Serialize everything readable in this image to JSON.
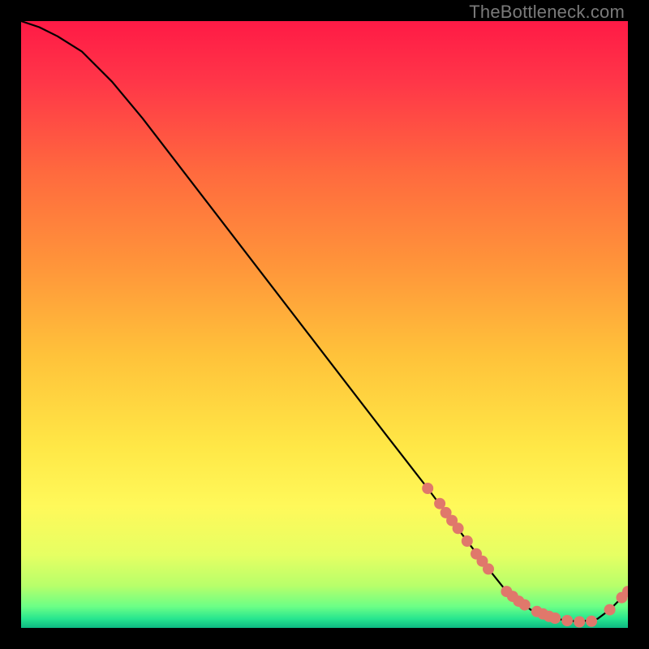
{
  "watermark": "TheBottleneck.com",
  "gradient_stops": [
    {
      "offset": 0.0,
      "color": "#ff1a46"
    },
    {
      "offset": 0.1,
      "color": "#ff3648"
    },
    {
      "offset": 0.25,
      "color": "#ff6a3e"
    },
    {
      "offset": 0.4,
      "color": "#ff943a"
    },
    {
      "offset": 0.55,
      "color": "#ffc23a"
    },
    {
      "offset": 0.7,
      "color": "#ffe746"
    },
    {
      "offset": 0.8,
      "color": "#fff95a"
    },
    {
      "offset": 0.88,
      "color": "#e6ff63"
    },
    {
      "offset": 0.93,
      "color": "#b8ff6a"
    },
    {
      "offset": 0.965,
      "color": "#6bff86"
    },
    {
      "offset": 0.985,
      "color": "#27e58f"
    },
    {
      "offset": 1.0,
      "color": "#0db982"
    }
  ],
  "chart_data": {
    "type": "line",
    "title": "",
    "xlabel": "",
    "ylabel": "",
    "xlim": [
      0,
      100
    ],
    "ylim": [
      0,
      100
    ],
    "series": [
      {
        "name": "bottleneck-curve",
        "x": [
          0,
          3,
          6,
          10,
          15,
          20,
          30,
          40,
          50,
          60,
          67,
          70,
          73,
          76,
          80,
          84,
          88,
          92,
          95,
          97,
          100
        ],
        "y": [
          100,
          99,
          97.5,
          95,
          90,
          84,
          71,
          58,
          45,
          32,
          23,
          19,
          15,
          11,
          6,
          3,
          1.5,
          1,
          1.5,
          3,
          6
        ]
      }
    ],
    "markers": {
      "name": "highlight-points",
      "x": [
        67,
        69,
        70,
        71,
        72,
        73.5,
        75,
        76,
        77,
        80,
        81,
        82,
        83,
        85,
        86,
        87,
        88,
        90,
        92,
        94,
        97,
        99,
        100
      ],
      "y": [
        23,
        20.5,
        19,
        17.7,
        16.4,
        14.3,
        12.2,
        11,
        9.7,
        6,
        5.2,
        4.4,
        3.8,
        2.7,
        2.3,
        1.9,
        1.6,
        1.2,
        1.0,
        1.1,
        3.0,
        5.0,
        6.0
      ]
    }
  }
}
